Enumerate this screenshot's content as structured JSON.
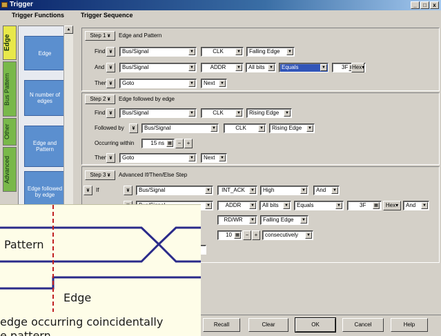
{
  "window": {
    "title": "Trigger",
    "minimize": "_",
    "maximize": "□",
    "close": "x"
  },
  "headers": {
    "functions": "Trigger Functions",
    "sequence": "Trigger Sequence"
  },
  "tabs": [
    "Edge",
    "Bus Pattern",
    "Other",
    "Advanced"
  ],
  "tiles": [
    "Edge",
    "N number of edges",
    "Edge and Pattern",
    "Edge followed by edge"
  ],
  "icons": {
    "step_menu": "chevron-down-icon",
    "dropdown": "triangle-down-icon",
    "keypad": "keypad-icon"
  },
  "step1": {
    "label": "Step 1",
    "chevron": "¥",
    "title": "Edge and Pattern",
    "find_label": "Find",
    "find_source": "Bus/Signal",
    "find_signal": "CLK",
    "find_edge": "Falling Edge",
    "and_label": "And",
    "and_source": "Bus/Signal",
    "and_signal": "ADDR",
    "and_bits": "All bits",
    "and_op": "Equals",
    "and_value": "3F",
    "and_base": "Hex",
    "then_label": "Then",
    "then_action": "Goto",
    "then_target": "Next"
  },
  "step2": {
    "label": "Step 2",
    "chevron": "¥",
    "title": "Edge followed by edge",
    "find_label": "Find",
    "find_source": "Bus/Signal",
    "find_signal": "CLK",
    "find_edge": "Rising Edge",
    "followed_label": "Followed by",
    "followed_source": "Bus/Signal",
    "followed_signal": "CLK",
    "followed_edge": "Rising Edge",
    "within_label": "Occurring within",
    "within_value": "15 ns",
    "minus": "−",
    "plus": "+",
    "then_label": "Then",
    "then_action": "Goto",
    "then_target": "Next"
  },
  "step3": {
    "label": "Step 3",
    "chevron": "¥",
    "title": "Advanced If/Then/Else Step",
    "if_label": "If",
    "row1_source": "Bus/Signal",
    "row1_signal": "INT_ACK",
    "row1_level": "High",
    "row1_logic": "And",
    "row2_source": "Bus/Signal",
    "row2_signal": "ADDR",
    "row2_bits": "All bits",
    "row2_op": "Equals",
    "row2_value": "3F",
    "row2_base": "Hex",
    "row2_logic": "And",
    "row3_signal": "RD/WR",
    "row3_edge": "Falling Edge",
    "count_value": "10",
    "minus": "−",
    "plus": "+",
    "count_mode": "consecutively"
  },
  "buttons": {
    "recall": "Recall",
    "clear": "Clear",
    "ok": "OK",
    "cancel": "Cancel",
    "help": "Help"
  },
  "callout": {
    "pattern_label": "Pattern",
    "edge_label": "Edge",
    "caption_line1": "edge occurring coincidentally",
    "caption_line2": "e pattern"
  },
  "colors": {
    "callout_bg": "#fefde8",
    "wave": "#2a2a8a",
    "marker": "#c02020",
    "tile": "#5b8fcf",
    "tab_active": "#e8e84a",
    "tab": "#79b84a"
  }
}
